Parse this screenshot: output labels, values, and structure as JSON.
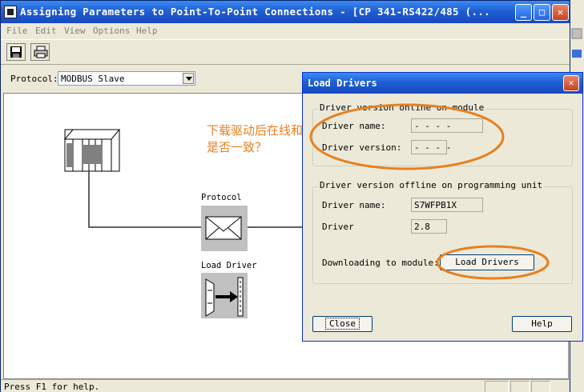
{
  "window": {
    "title": "Assigning Parameters to Point-To-Point Connections - [CP 341-RS422/485  (..."
  },
  "menu": [
    "File",
    "Edit",
    "View",
    "Options",
    "Help"
  ],
  "protocol": {
    "label": "Protocol:",
    "value": "MODBUS Slave"
  },
  "canvas": {
    "annotation_line1": "下载驱动后在线和离线",
    "annotation_line2": "是否一致？",
    "protocol_label": "Protocol",
    "load_drivers_label": "Load Driver"
  },
  "status": {
    "text": "Press F1 for help."
  },
  "dialog": {
    "title": "Load Drivers",
    "online": {
      "title": "Driver version online on module",
      "name_label": "Driver name:",
      "name_value": "- - - -",
      "version_label": "Driver version:",
      "version_value": "- - - -"
    },
    "offline": {
      "title": "Driver version offline on programming unit",
      "name_label": "Driver name:",
      "name_value": "S7WFPB1X",
      "version_label": "Driver",
      "version_value": "2.8",
      "download_label": "Downloading to module:",
      "load_button": "Load Drivers"
    },
    "close_button": "Close",
    "help_button": "Help"
  },
  "colors": {
    "annotation": "#e8801f",
    "titlebar": "#1f5fd3"
  }
}
